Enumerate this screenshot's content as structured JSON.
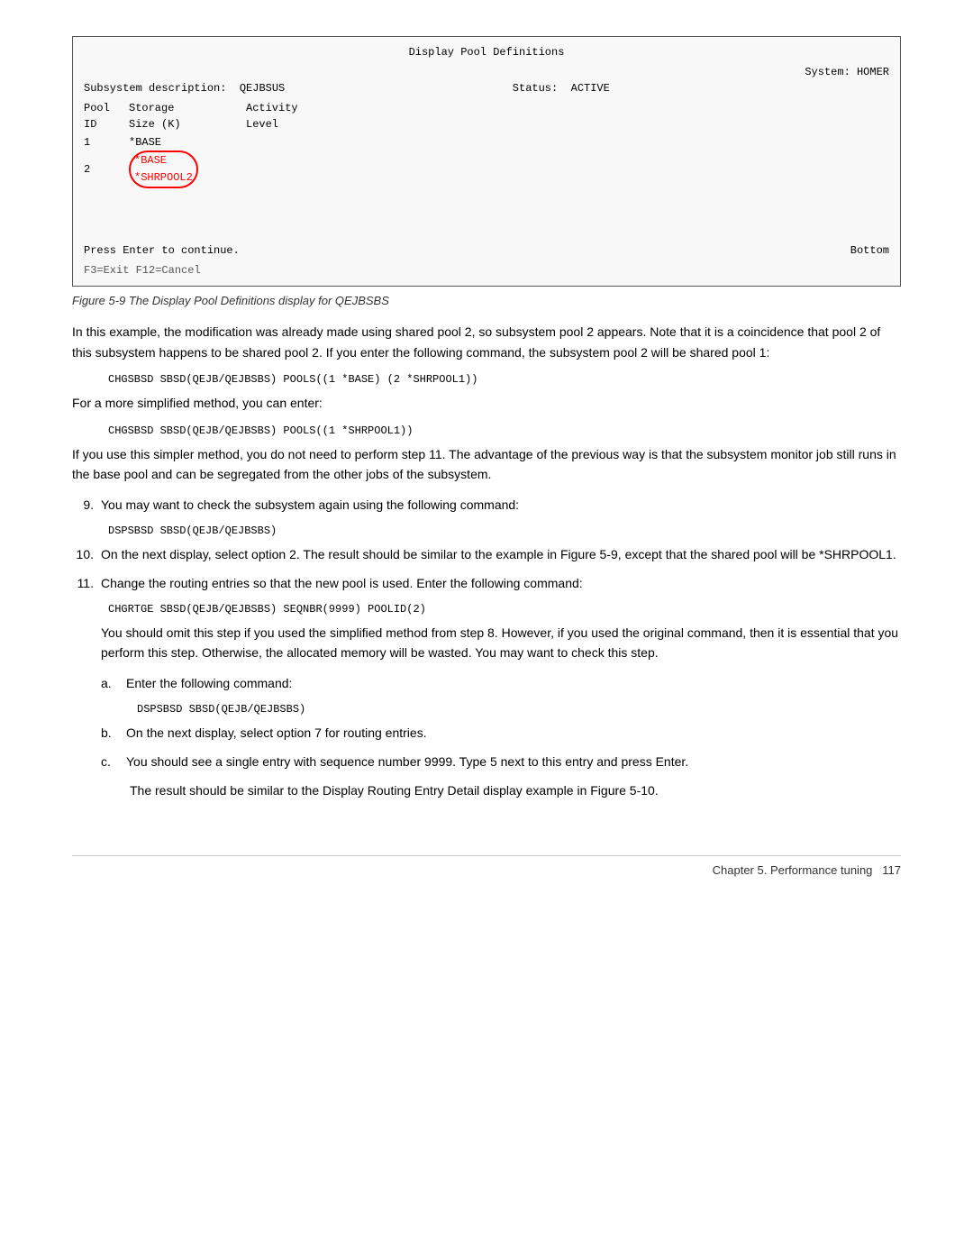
{
  "terminal": {
    "title": "Display Pool Definitions",
    "system_label": "System:",
    "system_value": "HOMER",
    "subsystem_label": "Subsystem description:",
    "subsystem_value": "QEJBSUS",
    "status_label": "Status:",
    "status_value": "ACTIVE",
    "col_pool_id": "Pool\nID",
    "col_storage": "Storage\nSize (K)",
    "col_activity": "Activity\nLevel",
    "pool_rows": [
      {
        "id": "1",
        "storage": "*BASE",
        "activity": ""
      },
      {
        "id": "2",
        "storage": "*SHRPOOL2",
        "activity": ""
      }
    ],
    "bottom_label": "Bottom",
    "press_message": "Press Enter to continue.",
    "commands": "F3=Exit   F12=Cancel"
  },
  "figure_caption": "Figure 5-9  The Display Pool Definitions display for QEJBSBS",
  "paragraphs": [
    "In this example, the modification was already made using shared pool 2, so subsystem pool 2 appears. Note that it is a coincidence that pool 2 of this subsystem happens to be shared pool 2. If you enter the following command, the subsystem pool 2 will be shared pool 1:",
    "For a more simplified method, you can enter:",
    "If you use this simpler method, you do not need to perform step 11. The advantage of the previous way is that the subsystem monitor job still runs in the base pool and can be segregated from the other jobs of the subsystem."
  ],
  "code_blocks": {
    "chgsbsd_full": "CHGSBSD SBSD(QEJB/QEJBSBS) POOLS((1 *BASE) (2 *SHRPOOL1))",
    "chgsbsd_simple": "CHGSBSD SBSD(QEJB/QEJBSBS) POOLS((1 *SHRPOOL1))",
    "dspsbsd_1": "DSPSBSD SBSD(QEJB/QEJBSBS)",
    "chgrtge": "CHGRTGE SBSD(QEJB/QEJBSBS) SEQNBR(9999) POOLID(2)",
    "dspsbsd_2": "DSPSBSD SBSD(QEJB/QEJBSBS)"
  },
  "numbered_items": [
    {
      "num": "9.",
      "text": "You may want to check the subsystem again using the following command:"
    },
    {
      "num": "10.",
      "text": "On the next display, select option 2. The result should be similar to the example in Figure 5-9, except that the shared pool will be *SHRPOOL1."
    },
    {
      "num": "11.",
      "text": "Change the routing entries so that the new pool is used. Enter the following command:"
    }
  ],
  "item11_extra": "You should omit this step if you used the simplified method from step 8. However, if you used the original command, then it is essential that you perform this step. Otherwise, the allocated memory will be wasted. You may want to check this step.",
  "lettered_items": [
    {
      "letter": "a.",
      "text": "Enter the following command:"
    },
    {
      "letter": "b.",
      "text": "On the next display, select option 7 for routing entries."
    },
    {
      "letter": "c.",
      "text": "You should see a single entry with sequence number 9999. Type 5 next to this entry and press Enter."
    }
  ],
  "result_text": "The result should be similar to the Display Routing Entry Detail display example in Figure 5-10.",
  "footer": {
    "chapter": "Chapter 5. Performance tuning",
    "page": "117"
  }
}
